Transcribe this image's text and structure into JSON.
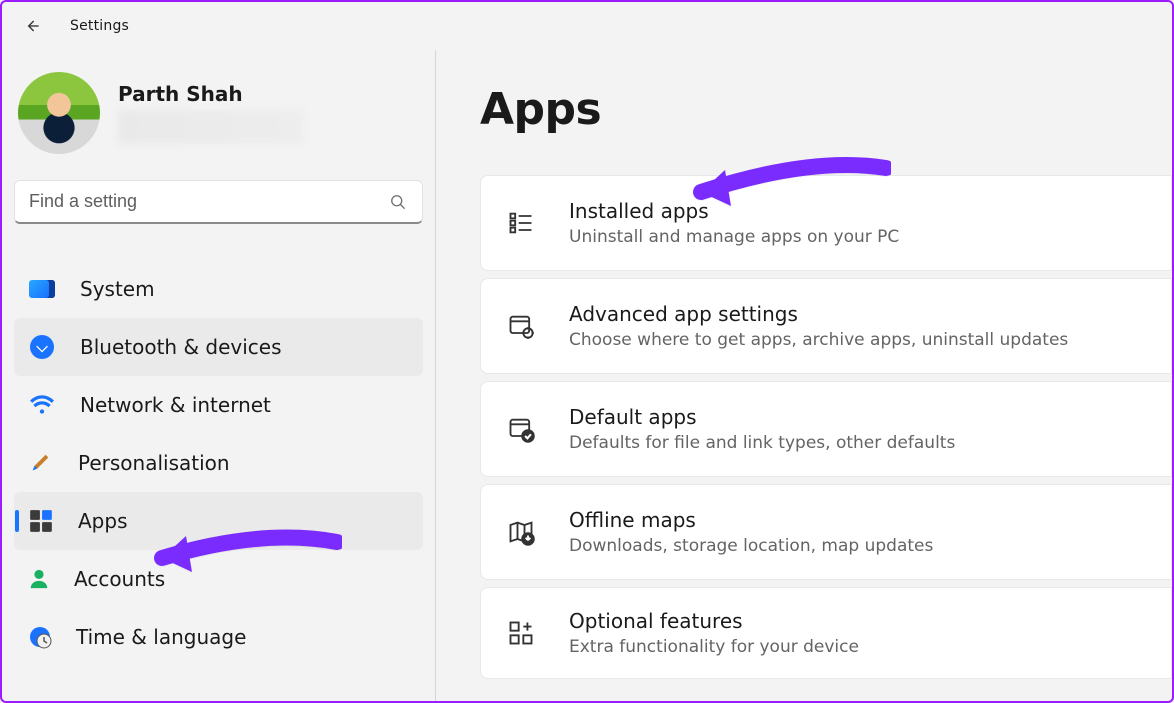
{
  "topbar": {
    "title": "Settings"
  },
  "profile": {
    "name": "Parth Shah"
  },
  "search": {
    "placeholder": "Find a setting"
  },
  "sidebar": {
    "items": [
      {
        "label": "System"
      },
      {
        "label": "Bluetooth & devices"
      },
      {
        "label": "Network & internet"
      },
      {
        "label": "Personalisation"
      },
      {
        "label": "Apps"
      },
      {
        "label": "Accounts"
      },
      {
        "label": "Time & language"
      }
    ]
  },
  "main": {
    "heading": "Apps",
    "cards": [
      {
        "title": "Installed apps",
        "sub": "Uninstall and manage apps on your PC"
      },
      {
        "title": "Advanced app settings",
        "sub": "Choose where to get apps, archive apps, uninstall updates"
      },
      {
        "title": "Default apps",
        "sub": "Defaults for file and link types, other defaults"
      },
      {
        "title": "Offline maps",
        "sub": "Downloads, storage location, map updates"
      },
      {
        "title": "Optional features",
        "sub": "Extra functionality for your device"
      }
    ]
  },
  "accent": "#7a2cff"
}
